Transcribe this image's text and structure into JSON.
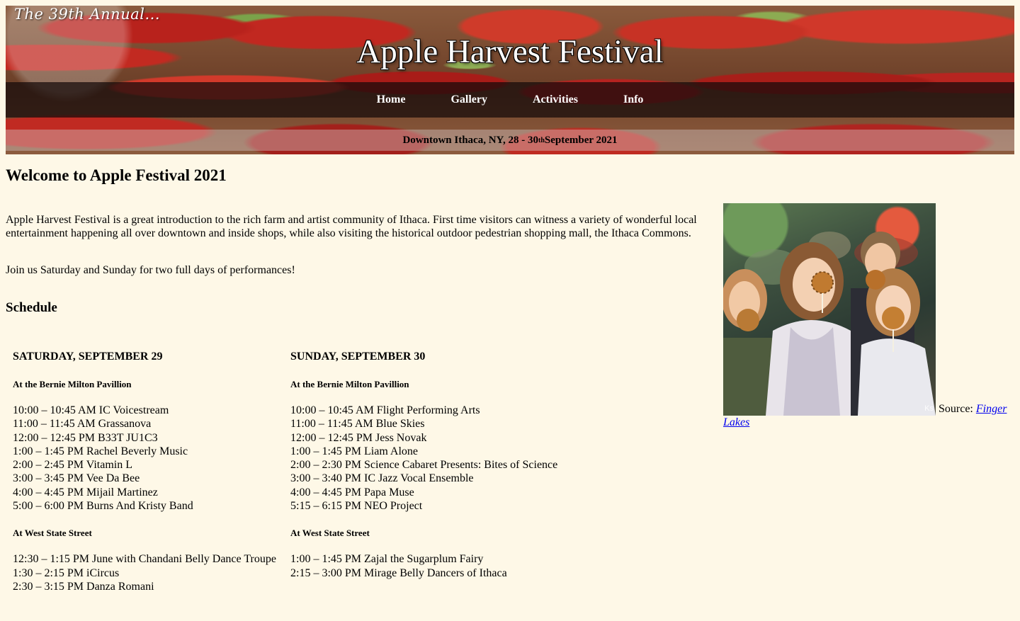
{
  "banner": {
    "tagline": "The 39th Annual...",
    "title": "Apple Harvest Festival",
    "nav": [
      {
        "label": "Home"
      },
      {
        "label": "Gallery"
      },
      {
        "label": "Activities"
      },
      {
        "label": "Info"
      }
    ],
    "date_prefix": "Downtown Ithaca, NY, 28 - 30",
    "date_sup": "th",
    "date_suffix": " September 2021"
  },
  "main": {
    "welcome_heading": "Welcome to Apple Festival 2021",
    "intro": "Apple Harvest Festival is a great introduction to the rich farm and artist community of Ithaca. First time visitors can witness a variety of wonderful local entertainment happening all over downtown and inside shops, while also visiting the historical outdoor pedestrian shopping mall, the Ithaca Commons.",
    "join": "Join us Saturday and Sunday for two full days of performances!",
    "schedule_heading": "Schedule"
  },
  "schedule": {
    "saturday": {
      "title": "SATURDAY, SEPTEMBER 29",
      "venue1": "At the Bernie Milton Pavillion",
      "slots1": [
        "10:00 – 10:45 AM IC Voicestream",
        "11:00 – 11:45 AM Grassanova",
        "12:00 – 12:45 PM B33T JU1C3",
        "1:00 – 1:45 PM Rachel Beverly Music",
        "2:00 – 2:45 PM Vitamin L",
        "3:00 – 3:45 PM Vee Da Bee",
        "4:00 – 4:45 PM Mijail Martinez",
        "5:00 – 6:00 PM Burns And Kristy Band"
      ],
      "venue2": "At West State Street",
      "slots2": [
        "12:30 – 1:15 PM June with Chandani Belly Dance Troupe",
        "1:30 – 2:15 PM iCircus",
        "2:30 – 3:15 PM Danza Romani"
      ]
    },
    "sunday": {
      "title": "SUNDAY, SEPTEMBER 30",
      "venue1": "At the Bernie Milton Pavillion",
      "slots1": [
        "10:00 – 10:45 AM Flight Performing Arts",
        "11:00 – 11:45 AM Blue Skies",
        "12:00 – 12:45 PM Jess Novak",
        "1:00 – 1:45 PM Liam Alone",
        "2:00 – 2:30 PM Science Cabaret Presents: Bites of Science",
        "3:00 – 3:40 PM IC Jazz Vocal Ensemble",
        "4:00 – 4:45 PM Papa Muse",
        "5:15 – 6:15 PM NEO Project"
      ],
      "venue2": "At West State Street",
      "slots2": [
        "1:00 – 1:45 PM Zajal the Sugarplum Fairy",
        "2:15 – 3:00 PM Mirage Belly Dancers of Ithaca"
      ]
    }
  },
  "photo": {
    "credit": "Ks",
    "source_label": " Source: ",
    "source_link": "Finger Lakes"
  },
  "colors": {
    "page_background": "#fef8e7",
    "link": "#0000ee",
    "nav_bar": "#140a0a"
  }
}
